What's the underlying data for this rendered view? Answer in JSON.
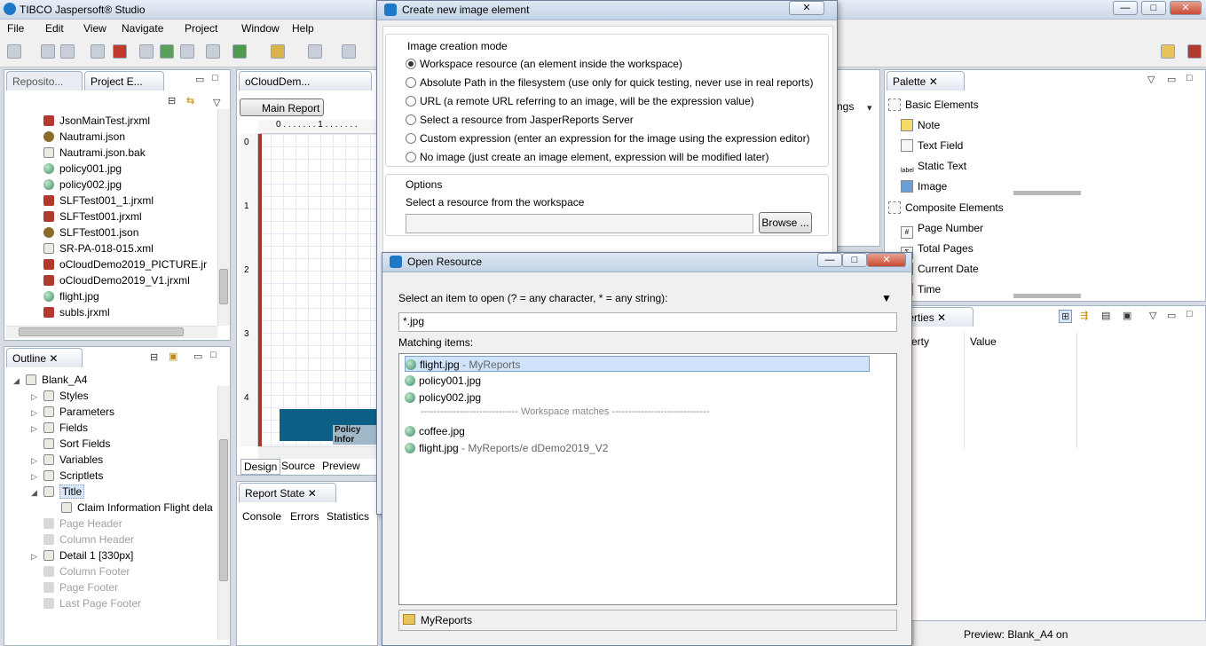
{
  "app": {
    "title": "TIBCO Jaspersoft® Studio",
    "window_controls": {
      "minimize": "—",
      "maximize": "□",
      "close": "✕"
    }
  },
  "menu": [
    "File",
    "Edit",
    "View",
    "Navigate",
    "Project",
    "Window",
    "Help"
  ],
  "left_top": {
    "tabs": [
      "Reposito...",
      "Project E..."
    ],
    "files": [
      {
        "name": "JsonMainTest.jrxml",
        "icon": "jrxml"
      },
      {
        "name": "Nautrami.json",
        "icon": "json"
      },
      {
        "name": "Nautrami.json.bak",
        "icon": "file"
      },
      {
        "name": "policy001.jpg",
        "icon": "image"
      },
      {
        "name": "policy002.jpg",
        "icon": "image"
      },
      {
        "name": "SLFTest001_1.jrxml",
        "icon": "jrxml"
      },
      {
        "name": "SLFTest001.jrxml",
        "icon": "jrxml"
      },
      {
        "name": "SLFTest001.json",
        "icon": "json"
      },
      {
        "name": "SR-PA-018-015.xml",
        "icon": "file"
      },
      {
        "name": "oCloudDemo2019_PICTURE.jr",
        "icon": "jrxml"
      },
      {
        "name": "oCloudDemo2019_V1.jrxml",
        "icon": "jrxml"
      },
      {
        "name": "flight.jpg",
        "icon": "image"
      },
      {
        "name": "subls.jrxml",
        "icon": "jrxml"
      }
    ]
  },
  "outline": {
    "tab": "Outline",
    "items": [
      {
        "label": "Blank_A4",
        "level": 0,
        "expander": "◢",
        "enabled": true
      },
      {
        "label": "Styles",
        "level": 1,
        "expander": "▷",
        "enabled": true
      },
      {
        "label": "Parameters",
        "level": 1,
        "expander": "▷",
        "enabled": true
      },
      {
        "label": "Fields",
        "level": 1,
        "expander": "▷",
        "enabled": true
      },
      {
        "label": "Sort Fields",
        "level": 1,
        "expander": "",
        "enabled": true
      },
      {
        "label": "Variables",
        "level": 1,
        "expander": "▷",
        "enabled": true
      },
      {
        "label": "Scriptlets",
        "level": 1,
        "expander": "▷",
        "enabled": true
      },
      {
        "label": "Title",
        "level": 1,
        "expander": "◢",
        "enabled": true
      },
      {
        "label": "Claim Information Flight dela",
        "level": 2,
        "expander": "",
        "enabled": true
      },
      {
        "label": "Page Header",
        "level": 1,
        "expander": "",
        "enabled": false
      },
      {
        "label": "Column Header",
        "level": 1,
        "expander": "",
        "enabled": false
      },
      {
        "label": "Detail 1 [330px]",
        "level": 1,
        "expander": "▷",
        "enabled": true
      },
      {
        "label": "Column Footer",
        "level": 1,
        "expander": "",
        "enabled": false
      },
      {
        "label": "Page Footer",
        "level": 1,
        "expander": "",
        "enabled": false
      },
      {
        "label": "Last Page Footer",
        "level": 1,
        "expander": "",
        "enabled": false
      }
    ]
  },
  "editor": {
    "tab": "oCloudDem...",
    "main_report_button": "Main Report",
    "ruler_top": "0 . . . . . . . 1 . . . . . . .",
    "ruler_left": [
      "0",
      "1",
      "2",
      "3",
      "4"
    ],
    "band_text": "Policy Infor",
    "bottom_tabs": [
      "Design",
      "Source",
      "Preview"
    ],
    "settings_label": "ngs"
  },
  "report_state": {
    "tab": "Report State",
    "tabs": [
      "Console",
      "Errors",
      "Statistics"
    ]
  },
  "palette": {
    "tab": "Palette",
    "basic_header": "Basic Elements",
    "basic": [
      "Note",
      "Text Field",
      "Static Text",
      "Image"
    ],
    "composite_header": "Composite Elements",
    "composite": [
      "Page Number",
      "Total Pages",
      "Current Date",
      "Time"
    ]
  },
  "properties": {
    "tab": "roperties",
    "col1": "erty",
    "col2": "Value"
  },
  "status": {
    "text": "Preview: Blank_A4 on"
  },
  "create_image_dialog": {
    "title": "Create new image element",
    "mode_group": "Image creation mode",
    "options": [
      {
        "label": "Workspace resource (an element inside the workspace)",
        "selected": true
      },
      {
        "label": "Absolute Path in the filesystem (use only for quick testing, never use in real reports)",
        "selected": false
      },
      {
        "label": "URL (a remote URL referring to an image, will be the expression value)",
        "selected": false
      },
      {
        "label": "Select a resource from JasperReports Server",
        "selected": false
      },
      {
        "label": "Custom expression (enter an expression for the image using the expression editor)",
        "selected": false
      },
      {
        "label": "No image (just create an image element, expression will be modified later)",
        "selected": false
      }
    ],
    "options_group": "Options",
    "resource_label": "Select a resource from the workspace",
    "browse_button": "Browse ..."
  },
  "open_resource_dialog": {
    "title": "Open Resource",
    "prompt": "Select an item to open (? = any character, * = any string):",
    "filter_value": "*.jpg",
    "matching_label": "Matching items:",
    "items": [
      {
        "name": "flight.jpg",
        "suffix": " - MyReports",
        "selected": true
      },
      {
        "name": "policy001.jpg",
        "suffix": "",
        "selected": false
      },
      {
        "name": "policy002.jpg",
        "suffix": "",
        "selected": false
      }
    ],
    "separator": "------------------------------ Workspace matches ------------------------------",
    "workspace_items": [
      {
        "name": "coffee.jpg",
        "suffix": ""
      },
      {
        "name": "flight.jpg",
        "suffix": " - MyReports/e            dDemo2019_V2"
      }
    ],
    "footer": "MyReports"
  },
  "colors": {
    "accent": "#1e78c8",
    "selection": "#cfe3fa",
    "band": "#0e5f86"
  }
}
